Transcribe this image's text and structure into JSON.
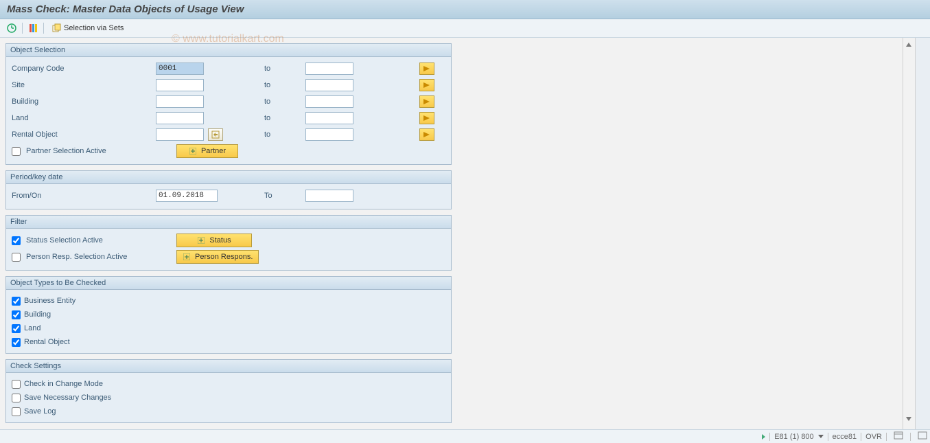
{
  "title": "Mass Check: Master Data Objects of Usage View",
  "toolbar": {
    "selection_via_sets": "Selection via Sets"
  },
  "watermark": "© www.tutorialkart.com",
  "panels": {
    "object_selection": {
      "title": "Object Selection",
      "rows": {
        "company_code": {
          "label": "Company Code",
          "from": "0001",
          "to": ""
        },
        "site": {
          "label": "Site",
          "from": "",
          "to": ""
        },
        "building": {
          "label": "Building",
          "from": "",
          "to": ""
        },
        "land": {
          "label": "Land",
          "from": "",
          "to": ""
        },
        "rental_object": {
          "label": "Rental Object",
          "from": "",
          "to": ""
        }
      },
      "partner_selection_label": "Partner Selection Active",
      "partner_button": "Partner",
      "to_label": "to"
    },
    "period": {
      "title": "Period/key date",
      "from_label": "From/On",
      "from_value": "01.09.2018",
      "to_label": "To",
      "to_value": ""
    },
    "filter": {
      "title": "Filter",
      "status_label": "Status Selection Active",
      "status_button": "Status",
      "person_label": "Person Resp. Selection Active",
      "person_button": "Person Respons."
    },
    "object_types": {
      "title": "Object Types to Be Checked",
      "items": {
        "business_entity": "Business Entity",
        "building": "Building",
        "land": "Land",
        "rental_object": "Rental Object"
      }
    },
    "check_settings": {
      "title": "Check Settings",
      "items": {
        "change_mode": "Check in Change Mode",
        "save_changes": "Save Necessary Changes",
        "save_log": "Save Log"
      }
    }
  },
  "statusbar": {
    "system": "E81 (1) 800",
    "server": "ecce81",
    "mode": "OVR"
  }
}
